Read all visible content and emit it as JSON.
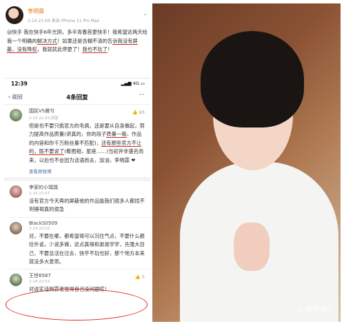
{
  "post": {
    "user": "李明霖",
    "meta": "2-14 21:04 来自 iPhone 11 Pro Max",
    "text_parts": [
      "@快手 我在快手6年光阴，多半青春首更快手！我希望这两天给我一个明确的",
      "解决方式",
      "！如果还是含糊不清的告",
      "诉我没有屏蔽，没有降权",
      "，我就就此停更了！",
      "我也不玩了",
      "！"
    ]
  },
  "phone": {
    "time": "12:39",
    "status": "4G",
    "back": "返回",
    "title": "4条回复",
    "more": "···"
  },
  "comments": [
    {
      "user": "国民VS晨兮",
      "time": "2-14 22:03 回复",
      "likes": "65",
      "text_parts": [
        "但是也不要只挑官方的毛病，还是要从自身做起，努力提高作品质量(讲真的，你的段子",
        "质量一般",
        "，作品的内容和你千万粉丝量不匹配)，",
        "还有那些官方不让的，既不要说了",
        "(看图相，星座……)当初并非盛名而来，以后也不会因为话语而去，加油，李明霖 ❤"
      ],
      "link": "查看原微博"
    },
    {
      "user": "李家的小瑞瑞",
      "time": "2-14 22:07",
      "likes": "",
      "text_parts": [
        "没有官方今天再的屏蔽他的作品能我们很多人都找不到锤哥真的很急"
      ]
    },
    {
      "user": "BlackS0509",
      "time": "2-14 22:02",
      "likes": "",
      "text_parts": [
        "对，不要在哪，都希望哥可以沉住气点，不要什么都往外说，少说多做，这点真得和弟弟学学，先强大自己，不要总活在过去，快乎不玩也好，那个地方本来就没多大意思。"
      ]
    },
    {
      "user": "王世8587",
      "time": "2-14 22:03",
      "likes": "5",
      "text_parts": [
        "对说实话明霖老觉得自己没问题哎！"
      ]
    }
  ],
  "photo": {
    "watermark": "剖析娱乐"
  },
  "colors": {
    "accent": "#e8750a",
    "highlight": "#e0221c",
    "link": "#4a73a8"
  }
}
